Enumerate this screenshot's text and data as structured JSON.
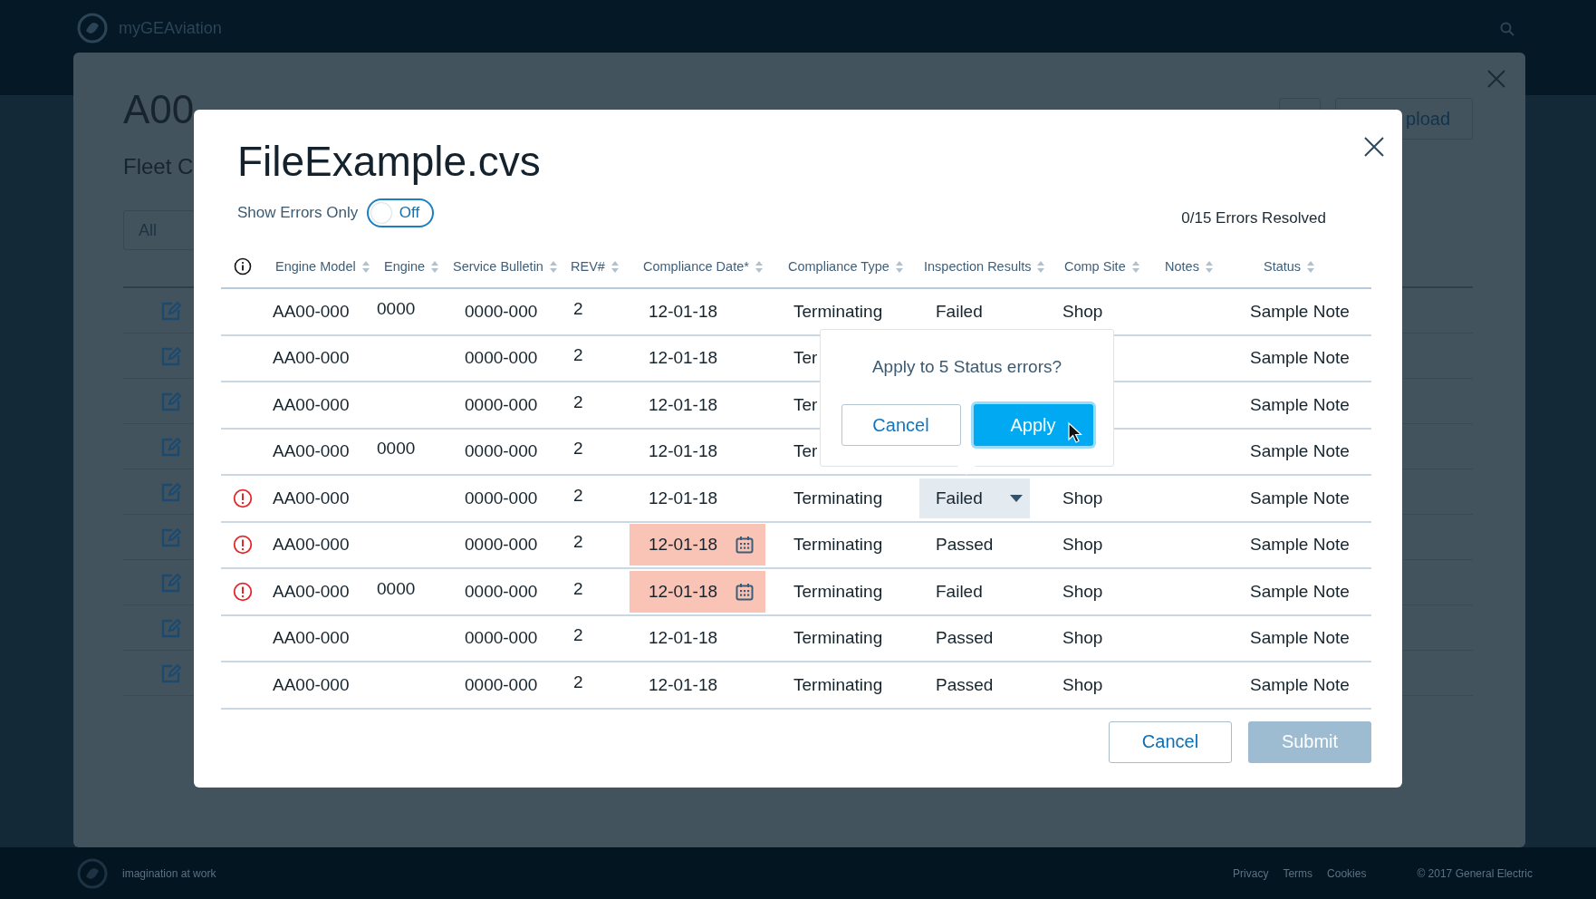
{
  "app_bar": {
    "brand": "myGEAviation"
  },
  "background_page": {
    "title": "A00",
    "upload_button": "pload",
    "section_title": "Fleet C",
    "filter": "All"
  },
  "dialog": {
    "title": "FileExample.cvs",
    "toggle": {
      "label": "Show Errors Only",
      "on": false,
      "state_text": "Off"
    },
    "progress": "0/15 Errors Resolved",
    "columns": [
      {
        "label": "Engine Model"
      },
      {
        "label": "Engine"
      },
      {
        "label": "Service Bulletin"
      },
      {
        "label": "REV#"
      },
      {
        "label": "Compliance Date*"
      },
      {
        "label": "Compliance Type"
      },
      {
        "label": "Inspection Results"
      },
      {
        "label": "Comp Site"
      },
      {
        "label": "Notes"
      },
      {
        "label": "Status"
      }
    ],
    "rows": [
      {
        "error": false,
        "model": "AA00-000",
        "engine": "0000",
        "bulletin": "0000-000",
        "rev": "2",
        "date": "12-01-18",
        "date_error": false,
        "type": "Terminating",
        "result": "Failed",
        "result_editing": false,
        "site": "Shop",
        "status": "Sample Note"
      },
      {
        "error": false,
        "model": "AA00-000",
        "bulletin": "0000-000",
        "rev": "2",
        "date": "12-01-18",
        "date_error": false,
        "type": "Ter",
        "result_editing": false,
        "status": "Sample Note"
      },
      {
        "error": false,
        "model": "AA00-000",
        "bulletin": "0000-000",
        "rev": "2",
        "date": "12-01-18",
        "date_error": false,
        "type": "Ter",
        "result_editing": false,
        "status": "Sample Note"
      },
      {
        "error": false,
        "model": "AA00-000",
        "engine": "0000",
        "bulletin": "0000-000",
        "rev": "2",
        "date": "12-01-18",
        "date_error": false,
        "type": "Ter",
        "result_editing": false,
        "status": "Sample Note"
      },
      {
        "error": true,
        "model": "AA00-000",
        "bulletin": "0000-000",
        "rev": "2",
        "date": "12-01-18",
        "date_error": false,
        "type": "Terminating",
        "result": "Failed",
        "result_editing": true,
        "site": "Shop",
        "status": "Sample Note"
      },
      {
        "error": true,
        "model": "AA00-000",
        "bulletin": "0000-000",
        "rev": "2",
        "date": "12-01-18",
        "date_error": true,
        "type": "Terminating",
        "result": "Passed",
        "result_editing": false,
        "site": "Shop",
        "status": "Sample Note"
      },
      {
        "error": true,
        "model": "AA00-000",
        "engine": "0000",
        "bulletin": "0000-000",
        "rev": "2",
        "date": "12-01-18",
        "date_error": true,
        "type": "Terminating",
        "result": "Failed",
        "result_editing": false,
        "site": "Shop",
        "status": "Sample Note"
      },
      {
        "error": false,
        "model": "AA00-000",
        "bulletin": "0000-000",
        "rev": "2",
        "date": "12-01-18",
        "date_error": false,
        "type": "Terminating",
        "result": "Passed",
        "result_editing": false,
        "site": "Shop",
        "status": "Sample Note"
      },
      {
        "error": false,
        "model": "AA00-000",
        "bulletin": "0000-000",
        "rev": "2",
        "date": "12-01-18",
        "date_error": false,
        "type": "Terminating",
        "result": "Passed",
        "result_editing": false,
        "site": "Shop",
        "status": "Sample Note"
      }
    ],
    "buttons": [
      {
        "label": "Cancel",
        "kind": "secondary",
        "disabled": false
      },
      {
        "label": "Submit",
        "kind": "primary",
        "disabled": true
      }
    ]
  },
  "popover": {
    "message": "Apply to 5 Status errors?",
    "buttons": [
      {
        "label": "Cancel",
        "kind": "secondary",
        "focused": false
      },
      {
        "label": "Apply",
        "kind": "primary",
        "focused": true
      }
    ]
  },
  "footer": {
    "tagline": "imagination at work",
    "links": [
      "Privacy",
      "Terms",
      "Cookies"
    ],
    "copyright": "© 2017 General Electric"
  }
}
